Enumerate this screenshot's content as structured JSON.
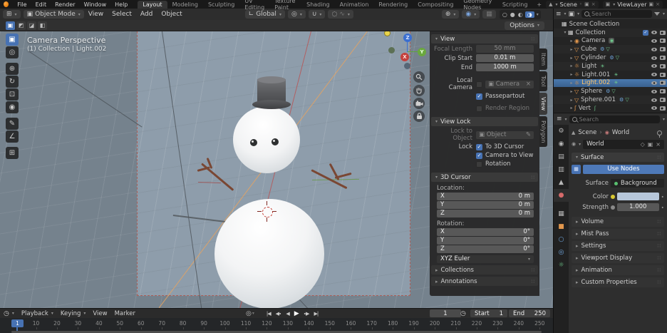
{
  "colors": {
    "accent": "#4772b3",
    "selected_text": "#ffc46b",
    "object_icon": "#e2974d",
    "data_icon_green": "#6fc98c",
    "data_icon_blue": "#71a8e0",
    "world_color_swatch": "#b7c7da",
    "viewport_bg": "#8e9dab"
  },
  "topbar": {
    "menus": [
      "File",
      "Edit",
      "Render",
      "Window",
      "Help"
    ],
    "workspaces": [
      "Layout",
      "Modeling",
      "Sculpting",
      "UV Editing",
      "Texture Paint",
      "Shading",
      "Animation",
      "Rendering",
      "Compositing",
      "Geometry Nodes",
      "Scripting"
    ],
    "active_workspace": "Layout",
    "new_workspace_label": "+",
    "scene_label": "Scene",
    "viewlayer_label": "ViewLayer"
  },
  "viewport_header": {
    "mode": "Object Mode",
    "menus": [
      "View",
      "Select",
      "Add",
      "Object"
    ],
    "orientation": "Global",
    "shading_modes": [
      {
        "name": "wireframe",
        "glyph": "○",
        "active": false
      },
      {
        "name": "solid",
        "glyph": "●",
        "active": false
      },
      {
        "name": "material-preview",
        "glyph": "◐",
        "active": false
      },
      {
        "name": "rendered",
        "glyph": "◑",
        "active": true
      }
    ],
    "options_label": "Options"
  },
  "toolsettings": {
    "select_modes": [
      "▣",
      "◩",
      "◪",
      "◧"
    ]
  },
  "toolbar": {
    "tools": [
      {
        "name": "select-box",
        "glyph": "▣",
        "active": true,
        "group_end": false
      },
      {
        "name": "cursor",
        "glyph": "◎",
        "active": false,
        "group_end": true
      },
      {
        "name": "move",
        "glyph": "⊕",
        "active": false,
        "group_end": false
      },
      {
        "name": "rotate",
        "glyph": "↻",
        "active": false,
        "group_end": false
      },
      {
        "name": "scale",
        "glyph": "⊡",
        "active": false,
        "group_end": false
      },
      {
        "name": "transform",
        "glyph": "◉",
        "active": false,
        "group_end": true
      },
      {
        "name": "annotate",
        "glyph": "✎",
        "active": false,
        "group_end": false
      },
      {
        "name": "measure",
        "glyph": "∠",
        "active": false,
        "group_end": true
      },
      {
        "name": "add-cube",
        "glyph": "⊞",
        "active": false,
        "group_end": false
      }
    ]
  },
  "viewport": {
    "view_label": "Camera Perspective",
    "context_label": "(1) Collection | Light.002",
    "axis_x": "X",
    "axis_y": "Y",
    "axis_z": "Z"
  },
  "npanel": {
    "tabs": [
      {
        "label": "Item",
        "active": false
      },
      {
        "label": "Tool",
        "active": false
      },
      {
        "label": "View",
        "active": true
      },
      {
        "label": "Polygon",
        "active": false
      }
    ],
    "view": {
      "title": "View",
      "focal_label": "Focal Length",
      "focal_value": "50 mm",
      "clip_label": "Clip Start",
      "clip_value": "0.01 m",
      "end_label": "End",
      "end_value": "1000 m",
      "local_camera_label": "Local Camera",
      "local_camera_value": "Camera",
      "passepartout_label": "Passepartout",
      "render_region_label": "Render Region"
    },
    "view_lock": {
      "title": "View Lock",
      "lock_to_object_label": "Lock to Object",
      "object_value": "Object",
      "lock_label": "Lock",
      "to_3d_cursor_label": "To 3D Cursor",
      "camera_to_view_label": "Camera to View",
      "rotation_label": "Rotation"
    },
    "cursor3d": {
      "title": "3D Cursor",
      "location_label": "Location:",
      "rotation_label": "Rotation:",
      "location": [
        {
          "axis": "X",
          "value": "0 m"
        },
        {
          "axis": "Y",
          "value": "0 m"
        },
        {
          "axis": "Z",
          "value": "0 m"
        }
      ],
      "rotation": [
        {
          "axis": "X",
          "value": "0°"
        },
        {
          "axis": "Y",
          "value": "0°"
        },
        {
          "axis": "Z",
          "value": "0°"
        }
      ],
      "euler_mode": "XYZ Euler"
    },
    "collections_label": "Collections",
    "annotations_label": "Annotations"
  },
  "outliner": {
    "search_placeholder": "Search",
    "rows": [
      {
        "label": "Scene Collection",
        "icon": "collection",
        "depth": 0,
        "expand": "",
        "check": false,
        "eye": false,
        "cam": false,
        "data": [],
        "selected": false
      },
      {
        "label": "Collection",
        "icon": "collection",
        "depth": 1,
        "expand": "▾",
        "check": true,
        "eye": true,
        "cam": true,
        "data": [],
        "selected": false
      },
      {
        "label": "Camera",
        "icon": "camera",
        "depth": 2,
        "expand": "▸",
        "check": false,
        "eye": true,
        "cam": true,
        "data": [
          "camera-data"
        ],
        "selected": false
      },
      {
        "label": "Cube",
        "icon": "mesh",
        "depth": 2,
        "expand": "▸",
        "check": false,
        "eye": true,
        "cam": true,
        "data": [
          "modifier",
          "mesh-data"
        ],
        "selected": false
      },
      {
        "label": "Cylinder",
        "icon": "mesh",
        "depth": 2,
        "expand": "▸",
        "check": false,
        "eye": true,
        "cam": true,
        "data": [
          "modifier",
          "mesh-data"
        ],
        "selected": false
      },
      {
        "label": "Light",
        "icon": "light",
        "depth": 2,
        "expand": "▸",
        "check": false,
        "eye": true,
        "cam": true,
        "data": [
          "light-data"
        ],
        "selected": false
      },
      {
        "label": "Light.001",
        "icon": "light",
        "depth": 2,
        "expand": "▸",
        "check": false,
        "eye": true,
        "cam": true,
        "data": [
          "light-data"
        ],
        "selected": false
      },
      {
        "label": "Light.002",
        "icon": "light",
        "depth": 2,
        "expand": "▸",
        "check": false,
        "eye": true,
        "cam": true,
        "data": [
          "light-data"
        ],
        "selected": true
      },
      {
        "label": "Sphere",
        "icon": "mesh",
        "depth": 2,
        "expand": "▸",
        "check": false,
        "eye": true,
        "cam": true,
        "data": [
          "modifier",
          "mesh-data"
        ],
        "selected": false
      },
      {
        "label": "Sphere.001",
        "icon": "mesh",
        "depth": 2,
        "expand": "▸",
        "check": false,
        "eye": true,
        "cam": true,
        "data": [
          "modifier",
          "mesh-data"
        ],
        "selected": false
      },
      {
        "label": "Vert",
        "icon": "curve",
        "depth": 2,
        "expand": "▸",
        "check": false,
        "eye": true,
        "cam": true,
        "data": [
          "curve-data"
        ],
        "selected": false
      }
    ]
  },
  "properties": {
    "search_placeholder": "Search",
    "breadcrumb": {
      "scene": "Scene",
      "separator": "›",
      "world": "World"
    },
    "world_name": "World",
    "tabs": [
      {
        "name": "tool",
        "glyph": "⚙",
        "color": "#b8b8b8",
        "active": false
      },
      {
        "name": "render",
        "glyph": "◉",
        "color": "#b8b8b8",
        "active": false
      },
      {
        "name": "output",
        "glyph": "▤",
        "color": "#b8b8b8",
        "active": false
      },
      {
        "name": "view-layer",
        "glyph": "▥",
        "color": "#b8b8b8",
        "active": false
      },
      {
        "name": "scene",
        "glyph": "▲",
        "color": "#b8b8b8",
        "active": false
      },
      {
        "name": "world",
        "glyph": "●",
        "color": "#d66a6a",
        "active": true
      },
      {
        "name": "collection",
        "glyph": "▦",
        "color": "#b8b8b8",
        "active": false
      },
      {
        "name": "object",
        "glyph": "■",
        "color": "#e2974d",
        "active": false
      },
      {
        "name": "physics",
        "glyph": "○",
        "color": "#71a8e0",
        "active": false
      },
      {
        "name": "constraints",
        "glyph": "◎",
        "color": "#71a8e0",
        "active": false
      },
      {
        "name": "object-data",
        "glyph": "☼",
        "color": "#6fc98c",
        "active": false
      }
    ],
    "surface": {
      "title": "Surface",
      "use_nodes_label": "Use Nodes",
      "surface_label": "Surface",
      "surface_value": "Background",
      "color_label": "Color",
      "strength_label": "Strength",
      "strength_value": "1.000"
    },
    "collapsed_panels": [
      "Volume",
      "Mist Pass",
      "Settings",
      "Viewport Display",
      "Animation",
      "Custom Properties"
    ]
  },
  "timeline": {
    "menus": [
      {
        "label": "Playback",
        "caret": true
      },
      {
        "label": "Keying",
        "caret": true
      },
      {
        "label": "View",
        "caret": false
      },
      {
        "label": "Marker",
        "caret": false
      }
    ],
    "playback_buttons": [
      {
        "name": "jump-to-start",
        "glyph": "|◀",
        "main": false
      },
      {
        "name": "previous-keyframe",
        "glyph": "◀∙",
        "main": false
      },
      {
        "name": "play-reverse",
        "glyph": "◀",
        "main": false
      },
      {
        "name": "play",
        "glyph": "▶",
        "main": true
      },
      {
        "name": "next-keyframe",
        "glyph": "∙▶",
        "main": false
      },
      {
        "name": "jump-to-end",
        "glyph": "▶|",
        "main": false
      }
    ],
    "current_frame": "1",
    "start_label": "Start",
    "start_value": "1",
    "end_label": "End",
    "end_value": "250",
    "ticks": [
      1,
      10,
      20,
      30,
      40,
      50,
      60,
      70,
      80,
      90,
      100,
      110,
      120,
      130,
      140,
      150,
      160,
      170,
      180,
      190,
      200,
      210,
      220,
      230,
      240,
      250
    ]
  }
}
